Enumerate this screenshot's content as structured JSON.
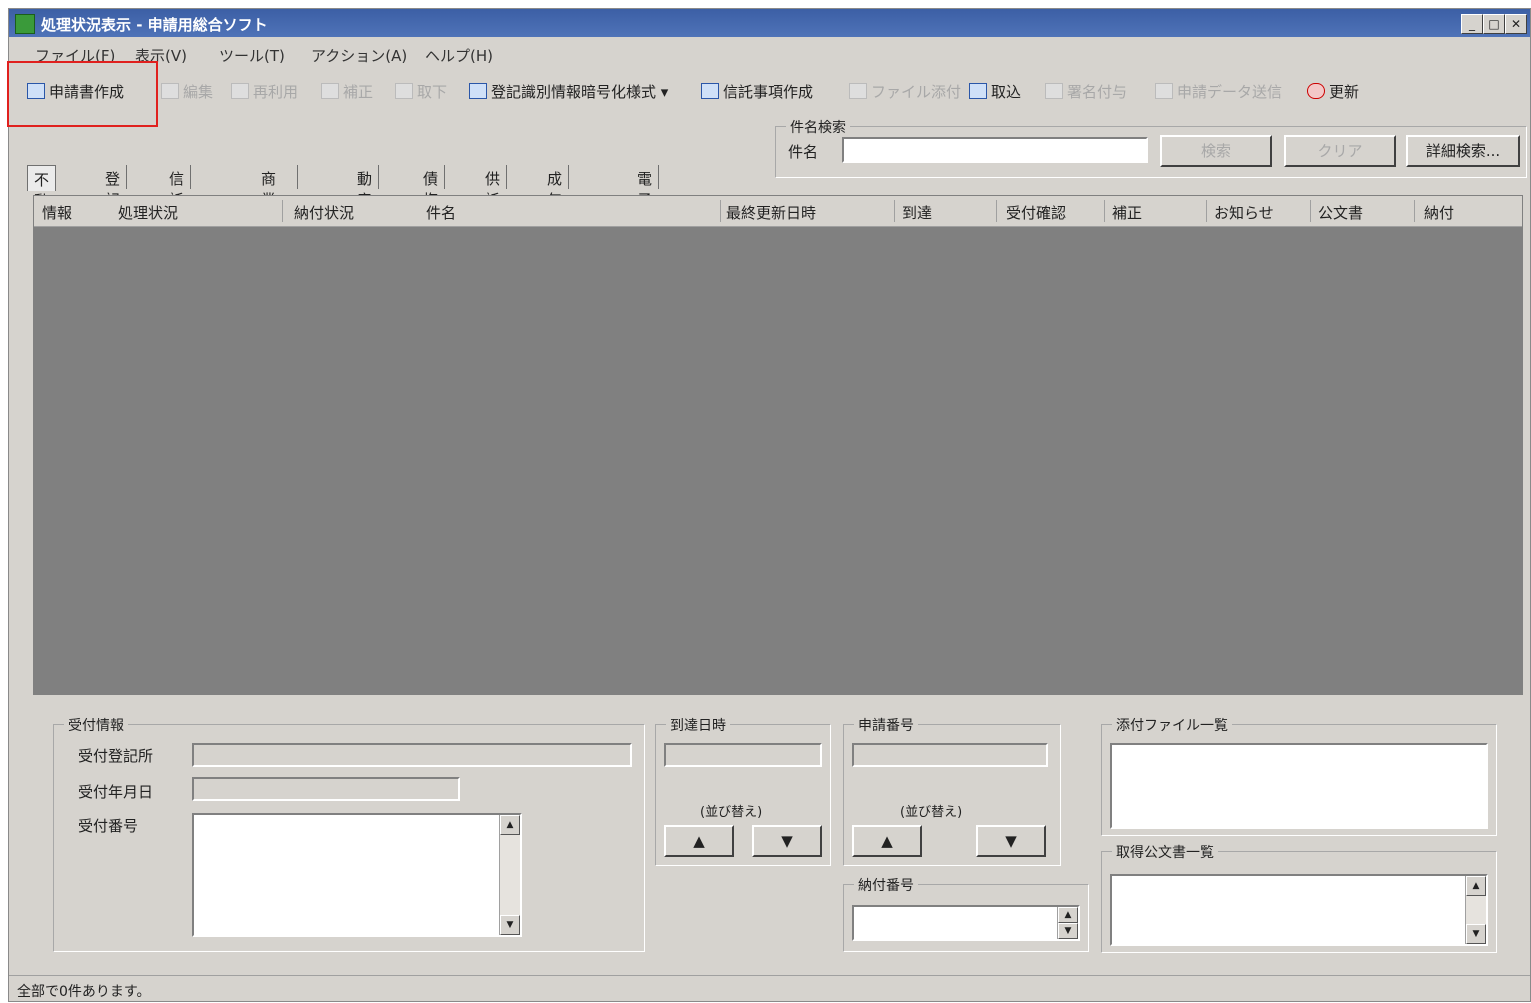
{
  "window": {
    "title": "処理状況表示 - 申請用総合ソフト",
    "controls": {
      "minimize": "_",
      "maximize": "□",
      "close": "✕"
    }
  },
  "menu": [
    {
      "label": "ファイル(F)"
    },
    {
      "label": "表示(V)"
    },
    {
      "label": "ツール(T)"
    },
    {
      "label": "アクション(A)"
    },
    {
      "label": "ヘルプ(H)"
    }
  ],
  "toolbar": [
    {
      "label": "申請書作成",
      "enabled": true,
      "icon": "new-document-icon"
    },
    {
      "label": "編集",
      "enabled": false,
      "icon": "edit-icon"
    },
    {
      "label": "再利用",
      "enabled": false,
      "icon": "copy-icon"
    },
    {
      "label": "補正",
      "enabled": false,
      "icon": "correct-icon"
    },
    {
      "label": "取下",
      "enabled": false,
      "icon": "withdraw-icon"
    },
    {
      "label": "登記識別情報暗号化様式 ▾",
      "enabled": true,
      "icon": "lock-document-icon"
    },
    {
      "label": "信託事項作成",
      "enabled": true,
      "icon": "table-icon"
    },
    {
      "label": "ファイル添付",
      "enabled": false,
      "icon": "attach-icon"
    },
    {
      "label": "取込",
      "enabled": true,
      "icon": "import-icon"
    },
    {
      "label": "署名付与",
      "enabled": false,
      "icon": "sign-icon"
    },
    {
      "label": "申請データ送信",
      "enabled": false,
      "icon": "send-icon"
    },
    {
      "label": "更新",
      "enabled": true,
      "icon": "refresh-icon"
    }
  ],
  "search": {
    "legend": "件名検索",
    "label": "件名",
    "value": "",
    "search_button": "検索",
    "clear_button": "クリア",
    "detail_button": "詳細検索..."
  },
  "tabs": [
    {
      "label": "不動産",
      "selected": true
    },
    {
      "label": "登記"
    },
    {
      "label": "信託事項"
    },
    {
      "label": "商業・法人"
    },
    {
      "label": "動産"
    },
    {
      "label": "債権"
    },
    {
      "label": "供託"
    },
    {
      "label": "成年後見"
    },
    {
      "label": "電子公証"
    }
  ],
  "table": {
    "columns": [
      "情報",
      "処理状況",
      "納付状況",
      "件名",
      "最終更新日時",
      "到達",
      "受付確認",
      "補正",
      "お知らせ",
      "公文書",
      "納付"
    ],
    "rows": []
  },
  "details": {
    "receipt": {
      "legend": "受付情報",
      "office_label": "受付登記所",
      "office_value": "",
      "date_label": "受付年月日",
      "date_value": "",
      "number_label": "受付番号",
      "number_value": ""
    },
    "arrival": {
      "legend": "到達日時",
      "value": "",
      "sort_label": "(並び替え)",
      "asc": "▲",
      "desc": "▼"
    },
    "application_number": {
      "legend": "申請番号",
      "value": "",
      "sort_label": "(並び替え)",
      "asc": "▲",
      "desc": "▼"
    },
    "payment_number": {
      "legend": "納付番号",
      "value": ""
    },
    "attachments": {
      "legend": "添付ファイル一覧"
    },
    "official_docs": {
      "legend": "取得公文書一覧"
    }
  },
  "status": {
    "text": "全部で0件あります。"
  }
}
